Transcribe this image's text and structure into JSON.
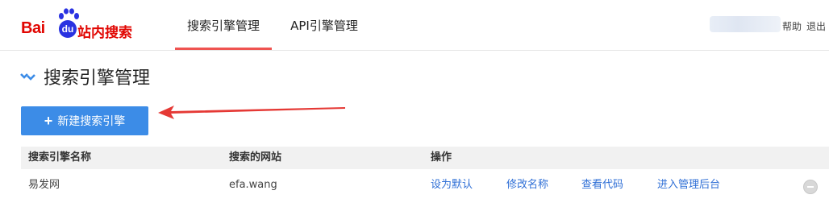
{
  "header": {
    "logo": {
      "text": "Bai",
      "badge": "du",
      "subtitle": "站内搜索"
    },
    "nav": [
      {
        "label": "搜索引擎管理",
        "active": true
      },
      {
        "label": "API引擎管理",
        "active": false
      }
    ],
    "help_label": "帮助",
    "logout_label": "退出"
  },
  "main": {
    "title": "搜索引擎管理",
    "new_button_icon": "+",
    "new_button_label": "新建搜索引擎"
  },
  "table": {
    "columns": [
      "搜索引擎名称",
      "搜索的网站",
      "操作"
    ],
    "rows": [
      {
        "name": "易发网",
        "site": "efa.wang",
        "actions": [
          "设为默认",
          "修改名称",
          "查看代码",
          "进入管理后台"
        ]
      }
    ]
  },
  "colors": {
    "brand_red": "#e10602",
    "brand_blue": "#2932e1",
    "primary_button": "#3c8ce7",
    "active_tab_underline": "#ef5350",
    "link": "#2f6fd6",
    "annotation_arrow": "#e53935"
  },
  "icons": {
    "title_icon": "chevron-down-icon",
    "row_toggle": "minus-circle-icon"
  }
}
